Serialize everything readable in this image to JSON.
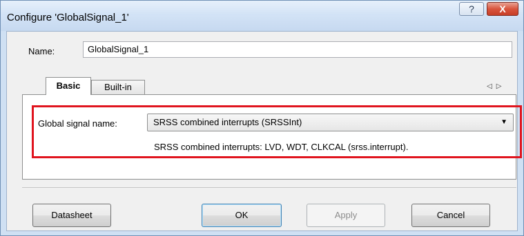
{
  "window": {
    "title": "Configure 'GlobalSignal_1'",
    "help_glyph": "?",
    "close_glyph": "X"
  },
  "name_field": {
    "label": "Name:",
    "value": "GlobalSignal_1"
  },
  "tabs": [
    {
      "label": "Basic",
      "selected": true
    },
    {
      "label": "Built-in",
      "selected": false
    }
  ],
  "tab_scroll": {
    "left": "◁",
    "right": "▷"
  },
  "global_signal": {
    "label": "Global signal name:",
    "selected": "SRSS combined interrupts (SRSSInt)",
    "description": "SRSS combined interrupts: LVD, WDT, CLKCAL (srss.interrupt)."
  },
  "buttons": {
    "datasheet": "Datasheet",
    "ok": "OK",
    "apply": "Apply",
    "cancel": "Cancel"
  },
  "colors": {
    "highlight_border": "#e0141e",
    "close_button": "#c63e26"
  }
}
